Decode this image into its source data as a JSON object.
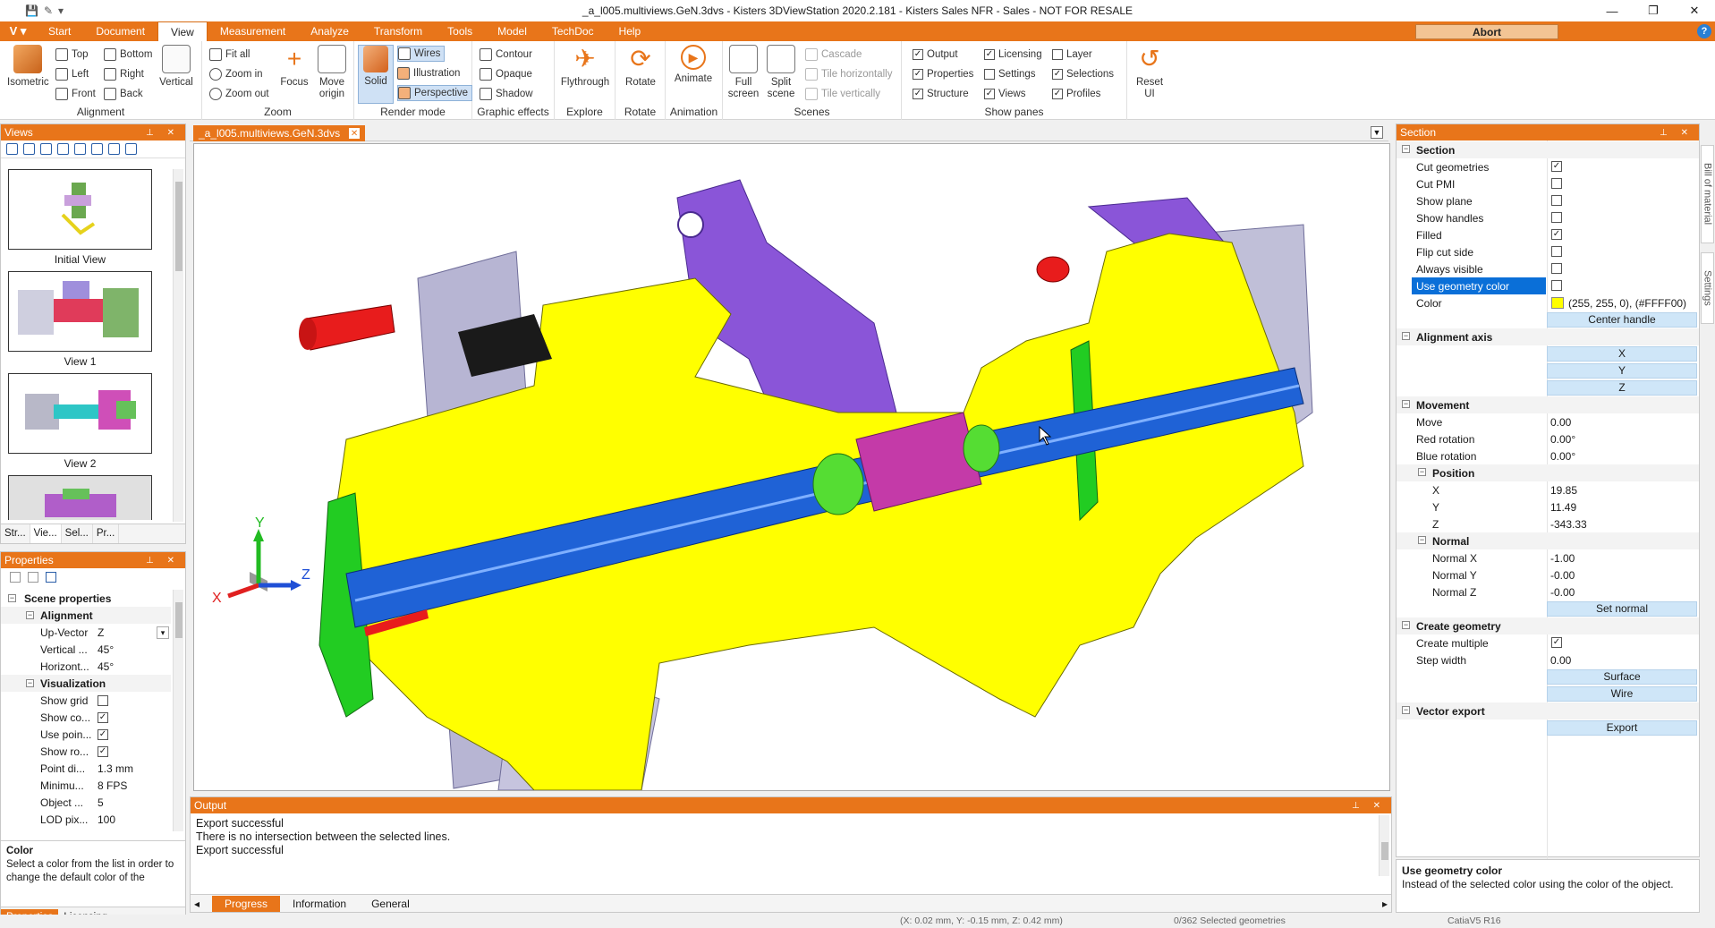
{
  "window": {
    "title": "_a_l005.multiviews.GeN.3dvs - Kisters 3DViewStation 2020.2.181 - Kisters Sales NFR - Sales - NOT FOR RESALE",
    "controls": [
      "—",
      "❐",
      "✕"
    ]
  },
  "ribbon_tabs": [
    "Start",
    "Document",
    "View",
    "Measurement",
    "Analyze",
    "Transform",
    "Tools",
    "Model",
    "TechDoc",
    "Help"
  ],
  "active_tab": "View",
  "abort_label": "Abort",
  "ribbon": {
    "alignment": {
      "label": "Alignment",
      "isometric": "Isometric",
      "top": "Top",
      "left": "Left",
      "front": "Front",
      "bottom": "Bottom",
      "right": "Right",
      "back": "Back",
      "vertical": "Vertical"
    },
    "zoom": {
      "label": "Zoom",
      "fit_all": "Fit all",
      "zoom_in": "Zoom in",
      "zoom_out": "Zoom out",
      "focus": "Focus",
      "move_origin_1": "Move",
      "move_origin_2": "origin"
    },
    "render": {
      "label": "Render mode",
      "solid": "Solid",
      "wires": "Wires",
      "illustration": "Illustration",
      "perspective": "Perspective"
    },
    "effects": {
      "label": "Graphic effects",
      "contour": "Contour",
      "opaque": "Opaque",
      "shadow": "Shadow"
    },
    "explore": {
      "label": "Explore",
      "flythrough": "Flythrough"
    },
    "rotate": {
      "label": "Rotate",
      "rotate": "Rotate"
    },
    "animation": {
      "label": "Animation",
      "animate": "Animate"
    },
    "scenes": {
      "label": "Scenes",
      "full_1": "Full",
      "full_2": "screen",
      "split_1": "Split",
      "split_2": "scene",
      "cascade": "Cascade",
      "tile_h": "Tile horizontally",
      "tile_v": "Tile vertically"
    },
    "panes": {
      "label": "Show panes",
      "output": "Output",
      "properties": "Properties",
      "structure": "Structure",
      "licensing": "Licensing",
      "settings": "Settings",
      "views": "Views",
      "layer": "Layer",
      "selections": "Selections",
      "profiles": "Profiles"
    },
    "reset": {
      "label_1": "Reset",
      "label_2": "UI"
    }
  },
  "views_panel": {
    "title": "Views",
    "items": [
      "Initial View",
      "View 1",
      "View 2"
    ],
    "tabs": [
      "Str...",
      "Vie...",
      "Sel...",
      "Pr..."
    ]
  },
  "properties_panel": {
    "title": "Properties",
    "scene_properties": "Scene properties",
    "alignment": "Alignment",
    "up_vector_k": "Up-Vector",
    "up_vector_v": "Z",
    "vertical_k": "Vertical ...",
    "vertical_v": "45°",
    "horizontal_k": "Horizont...",
    "horizontal_v": "45°",
    "visualization": "Visualization",
    "show_grid": "Show grid",
    "show_co": "Show co...",
    "use_poin": "Use poin...",
    "show_ro": "Show ro...",
    "point_di_k": "Point di...",
    "point_di_v": "1.3 mm",
    "minimum_k": "Minimu...",
    "minimum_v": "8 FPS",
    "object_k": "Object ...",
    "object_v": "5",
    "lod_k": "LOD pix...",
    "lod_v": "100",
    "desc_title": "Color",
    "desc_text": "Select a color from the list in order to change the default color of the",
    "tabs": [
      "Properties",
      "Licensing"
    ]
  },
  "document_tab": "_a_l005.multiviews.GeN.3dvs",
  "axes": {
    "x": "X",
    "y": "Y",
    "z": "Z"
  },
  "output_panel": {
    "title": "Output",
    "lines": [
      "Export successful",
      "There is no intersection between the selected lines.",
      "Export successful"
    ],
    "tabs": [
      "Progress",
      "Information",
      "General"
    ]
  },
  "section_panel": {
    "title": "Section",
    "section": "Section",
    "cut_geometries": "Cut geometries",
    "cut_pmi": "Cut PMI",
    "show_plane": "Show plane",
    "show_handles": "Show handles",
    "filled": "Filled",
    "flip_cut_side": "Flip cut side",
    "always_visible": "Always visible",
    "use_geometry_color": "Use geometry color",
    "color_k": "Color",
    "color_v": "(255, 255, 0), (#FFFF00)",
    "center_handle": "Center handle",
    "alignment_axis": "Alignment axis",
    "axis_x": "X",
    "axis_y": "Y",
    "axis_z": "Z",
    "movement": "Movement",
    "move_k": "Move",
    "move_v": "0.00",
    "red_rot_k": "Red rotation",
    "red_rot_v": "0.00°",
    "blue_rot_k": "Blue rotation",
    "blue_rot_v": "0.00°",
    "position": "Position",
    "pos_x_k": "X",
    "pos_x_v": "19.85",
    "pos_y_k": "Y",
    "pos_y_v": "11.49",
    "pos_z_k": "Z",
    "pos_z_v": "-343.33",
    "normal": "Normal",
    "nx_k": "Normal X",
    "nx_v": "-1.00",
    "ny_k": "Normal Y",
    "ny_v": "-0.00",
    "nz_k": "Normal Z",
    "nz_v": "-0.00",
    "set_normal": "Set normal",
    "create_geometry": "Create geometry",
    "create_multiple": "Create multiple",
    "step_width_k": "Step width",
    "step_width_v": "0.00",
    "surface": "Surface",
    "wire": "Wire",
    "vector_export": "Vector export",
    "export": "Export",
    "desc_title": "Use geometry color",
    "desc_text": "Instead of the selected color using the color of the object."
  },
  "side_tabs": [
    "Bill of material",
    "Settings"
  ],
  "status": {
    "coords": "(X: 0.02 mm, Y: -0.15 mm, Z: 0.42 mm)",
    "selected": "0/362 Selected geometries",
    "format": "CatiaV5 R16"
  },
  "colors": {
    "accent": "#e8751a",
    "section_fill": "#FFFF00",
    "selection": "#0a6fd8"
  }
}
